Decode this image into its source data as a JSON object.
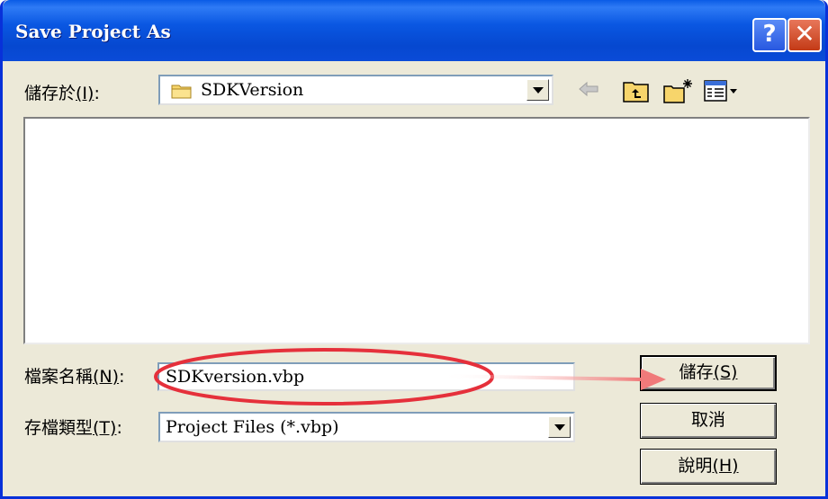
{
  "window": {
    "title": "Save Project As",
    "help_glyph": "?",
    "close_glyph": "✕"
  },
  "look_in": {
    "label": "儲存於",
    "mnemonic": "(I)",
    "suffix": ":",
    "value": "SDKVersion",
    "icon": "folder-icon"
  },
  "toolbar": {
    "icons": [
      "back-icon",
      "up-folder-icon",
      "new-folder-icon",
      "views-menu-icon"
    ]
  },
  "file_name": {
    "label": "檔案名稱",
    "mnemonic": "(N)",
    "suffix": ":",
    "value": "SDKversion.vbp"
  },
  "file_type": {
    "label": "存檔類型",
    "mnemonic": "(T)",
    "suffix": ":",
    "value": "Project Files (*.vbp)"
  },
  "buttons": {
    "save": {
      "label": "儲存",
      "mnemonic": "(S)"
    },
    "cancel": {
      "label": "取消"
    },
    "help": {
      "label": "說明",
      "mnemonic": "(H)"
    }
  },
  "annotation": {
    "color": "#e5303b",
    "arrow_color": "#f07a7a"
  }
}
